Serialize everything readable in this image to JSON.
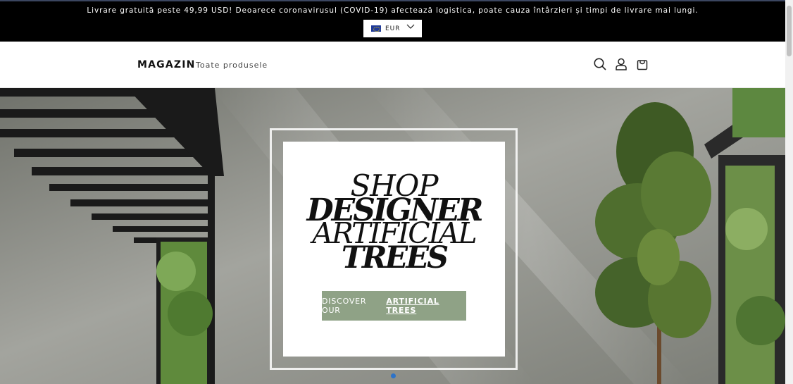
{
  "announcement": {
    "text": "Livrare gratuită peste 49,99 USD! Deoarece coronavirusul (COVID-19) afectează logistica, poate cauza întârzieri și timpi de livrare mai lungi."
  },
  "currency": {
    "code": "EUR",
    "flag_icon": "eu-flag-icon",
    "chevron_icon": "chevron-down-icon"
  },
  "header": {
    "logo": "MAGAZIN",
    "nav": [
      {
        "label": "Toate produsele"
      }
    ],
    "icons": [
      "search-icon",
      "account-icon",
      "cart-icon"
    ]
  },
  "hero": {
    "promo_lines": [
      "SHOP",
      "DESIGNER",
      "ARTIFICIAL",
      "TREES"
    ],
    "cta_prefix": "DISCOVER OUR",
    "cta_emphasis": "ARTIFICIAL TREES",
    "slide_count": 1,
    "active_slide": 1,
    "colors": {
      "cta_bg": "#8fa286",
      "dot": "#2d73c8"
    }
  }
}
